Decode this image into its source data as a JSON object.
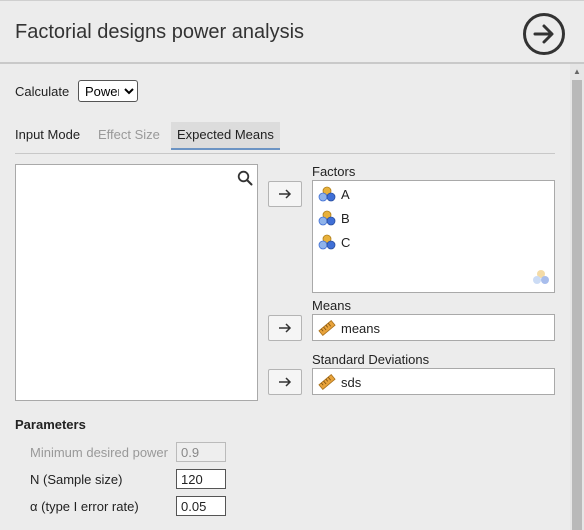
{
  "header": {
    "title": "Factorial designs power analysis"
  },
  "calculate": {
    "label": "Calculate",
    "options": [
      "Power"
    ],
    "selected": "Power"
  },
  "tabs": {
    "mode_label": "Input Mode",
    "effect_size": "Effect Size",
    "expected_means": "Expected Means"
  },
  "factors": {
    "label": "Factors",
    "items": [
      "A",
      "B",
      "C"
    ]
  },
  "means": {
    "label": "Means",
    "value": "means"
  },
  "sds": {
    "label": "Standard Deviations",
    "value": "sds"
  },
  "parameters": {
    "title": "Parameters",
    "min_power": {
      "label": "Minimum desired power",
      "value": "0.9"
    },
    "n": {
      "label": "N (Sample size)",
      "value": "120"
    },
    "alpha": {
      "label": "α (type I error rate)",
      "value": "0.05"
    }
  },
  "colors": {
    "accent": "#6b93c3",
    "nominal_orange": "#e8b13b",
    "nominal_blue": "#3f6fd6",
    "scale_orange": "#e8a33b"
  }
}
